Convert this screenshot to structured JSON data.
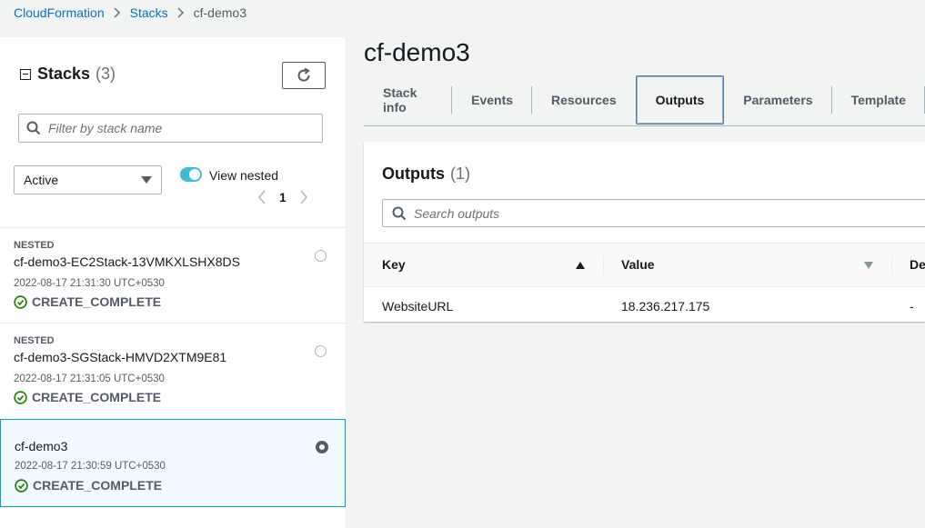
{
  "breadcrumb": {
    "items": [
      "CloudFormation",
      "Stacks",
      "cf-demo3"
    ]
  },
  "left_panel": {
    "title": "Stacks",
    "count": "(3)",
    "filter_placeholder": "Filter by stack name",
    "status_filter": "Active",
    "view_nested_label": "View nested",
    "view_nested_on": true,
    "page_number": "1",
    "stacks": [
      {
        "badge": "NESTED",
        "name": "cf-demo3-EC2Stack-13VMKXLSHX8DS",
        "time": "2022-08-17 21:31:30 UTC+0530",
        "status": "CREATE_COMPLETE",
        "selected": false
      },
      {
        "badge": "NESTED",
        "name": "cf-demo3-SGStack-HMVD2XTM9E81",
        "time": "2022-08-17 21:31:05 UTC+0530",
        "status": "CREATE_COMPLETE",
        "selected": false
      },
      {
        "badge": "",
        "name": "cf-demo3",
        "time": "2022-08-17 21:30:59 UTC+0530",
        "status": "CREATE_COMPLETE",
        "selected": true
      }
    ]
  },
  "main": {
    "title": "cf-demo3",
    "tabs": [
      "Stack info",
      "Events",
      "Resources",
      "Outputs",
      "Parameters",
      "Template"
    ],
    "active_tab": "Outputs",
    "outputs": {
      "title": "Outputs",
      "count": "(1)",
      "search_placeholder": "Search outputs",
      "columns": [
        "Key",
        "Value",
        "De"
      ],
      "rows": [
        {
          "key": "WebsiteURL",
          "value": "18.236.217.175",
          "description": "-"
        }
      ]
    }
  },
  "colors": {
    "link": "#0073bb",
    "toggle": "#44b9d6",
    "selected_border": "#00a1c9",
    "status_success": "#1d8102"
  }
}
